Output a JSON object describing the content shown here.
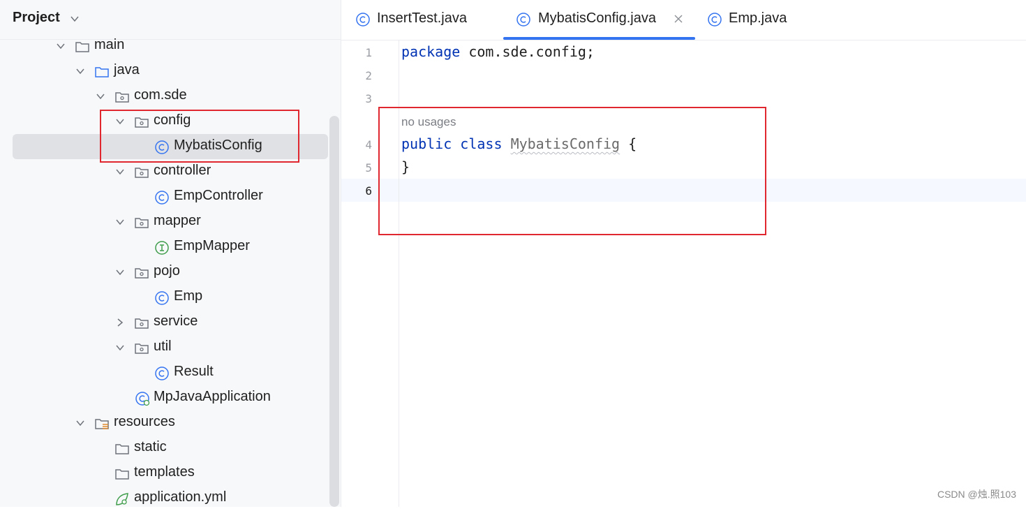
{
  "sidebar": {
    "title": "Project",
    "tree": [
      {
        "label": "main"
      },
      {
        "label": "java"
      },
      {
        "label": "com.sde"
      },
      {
        "label": "config"
      },
      {
        "label": "MybatisConfig"
      },
      {
        "label": "controller"
      },
      {
        "label": "EmpController"
      },
      {
        "label": "mapper"
      },
      {
        "label": "EmpMapper"
      },
      {
        "label": "pojo"
      },
      {
        "label": "Emp"
      },
      {
        "label": "service"
      },
      {
        "label": "util"
      },
      {
        "label": "Result"
      },
      {
        "label": "MpJavaApplication"
      },
      {
        "label": "resources"
      },
      {
        "label": "static"
      },
      {
        "label": "templates"
      },
      {
        "label": "application.yml"
      }
    ]
  },
  "tabs": [
    {
      "label": "InsertTest.java"
    },
    {
      "label": "MybatisConfig.java"
    },
    {
      "label": "Emp.java"
    }
  ],
  "editor": {
    "line_numbers": [
      "1",
      "2",
      "3",
      "4",
      "5",
      "6"
    ],
    "line1_kw": "package",
    "line1_rest": " com.sde.config;",
    "hint": "no usages",
    "line4_kw1": "public",
    "line4_kw2": "class",
    "line4_class": "MybatisConfig",
    "line4_brace": " {",
    "line5": "}"
  },
  "watermark": "CSDN @烛.照103",
  "colors": {
    "accent": "#3574f0",
    "highlight_box": "#e0262e",
    "keyword": "#0033b3"
  }
}
